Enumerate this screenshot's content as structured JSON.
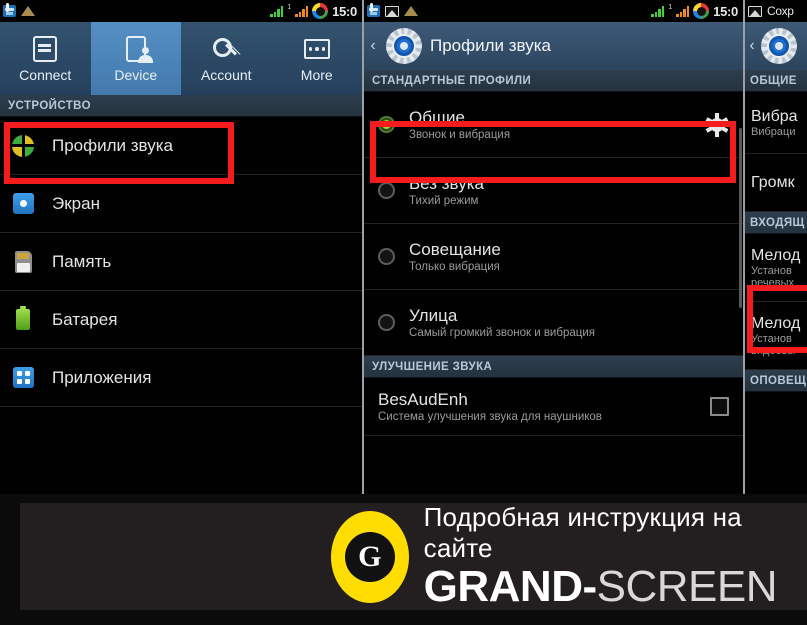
{
  "panels": {
    "left": {
      "statusbar": {
        "icons": [
          "folder-icon",
          "sandglass-icon"
        ],
        "signal_icons": [
          "signal-bars-green-icon",
          "signal-bars-orange-icon",
          "color-ring-icon"
        ],
        "time": "15:0"
      },
      "tabs": [
        {
          "label": "Connect",
          "icon": "connect-icon",
          "active": false
        },
        {
          "label": "Device",
          "icon": "device-icon",
          "active": true
        },
        {
          "label": "Account",
          "icon": "key-icon",
          "active": false
        },
        {
          "label": "More",
          "icon": "more-dots-icon",
          "active": false
        }
      ],
      "section_header": "УСТРОЙСТВО",
      "items": [
        {
          "label": "Профили звука",
          "icon": "sound-profiles-icon",
          "highlighted": true
        },
        {
          "label": "Экран",
          "icon": "display-icon",
          "highlighted": false
        },
        {
          "label": "Память",
          "icon": "storage-icon",
          "highlighted": false
        },
        {
          "label": "Батарея",
          "icon": "battery-icon",
          "highlighted": false
        },
        {
          "label": "Приложения",
          "icon": "applications-icon",
          "highlighted": false
        }
      ]
    },
    "middle": {
      "statusbar": {
        "icons": [
          "folder-icon",
          "image-icon",
          "sandglass-icon"
        ],
        "signal_icons": [
          "signal-bars-green-icon",
          "signal-bars-orange-icon",
          "color-ring-icon"
        ],
        "time": "15:0"
      },
      "title": "Профили звука",
      "back_label": "‹",
      "sections": [
        {
          "header": "СТАНДАРТНЫЕ ПРОФИЛИ",
          "rows": [
            {
              "title": "Общие",
              "sub": "Звонок и вибрация",
              "selected": true,
              "gear": true,
              "highlighted": true
            },
            {
              "title": "Без звука",
              "sub": "Тихий режим",
              "selected": false,
              "gear": false,
              "highlighted": false
            },
            {
              "title": "Совещание",
              "sub": "Только вибрация",
              "selected": false,
              "gear": false,
              "highlighted": false
            },
            {
              "title": "Улица",
              "sub": "Самый громкий звонок и вибрация",
              "selected": false,
              "gear": false,
              "highlighted": false
            }
          ]
        },
        {
          "header": "УЛУЧШЕНИЕ ЗВУКА",
          "rows": [
            {
              "title": "BesAudEnh",
              "sub": "Система улучшения звука для наушников",
              "checkbox": true,
              "checked": false
            }
          ]
        }
      ]
    },
    "right": {
      "statusbar": {
        "icons": [
          "image-icon"
        ],
        "text": "Сохр"
      },
      "sections": [
        {
          "header": "ОБЩИЕ",
          "rows": [
            {
              "title": "Вибра",
              "sub": "Вибраци",
              "highlighted": false
            },
            {
              "title": "Громк",
              "sub": "",
              "highlighted": false
            }
          ]
        },
        {
          "header": "ВХОДЯЩ",
          "rows": [
            {
              "title": "Мелод",
              "sub": "Установ",
              "sub2": "речевых",
              "highlighted": true
            },
            {
              "title": "Мелод",
              "sub": "Установ",
              "sub2": "видеовы",
              "highlighted": false
            }
          ]
        },
        {
          "header": "ОПОВЕЩ",
          "rows": []
        }
      ]
    }
  },
  "banner": {
    "logo_letter": "G",
    "line1": "Подробная инструкция на сайте",
    "brand_bold": "GRAND-",
    "brand_light": "SCREEN"
  },
  "colors": {
    "highlight_red": "#f41c1c",
    "tab_active_blue": "#4c87bd",
    "banner_yellow": "#ffdd00",
    "banner_bg": "#231f20"
  }
}
